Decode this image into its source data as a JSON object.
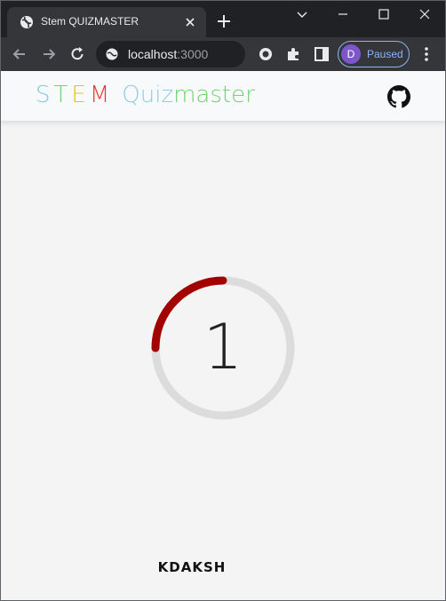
{
  "browser": {
    "tab_title": "Stem QUIZMASTER",
    "url_host": "localhost",
    "url_port": ":3000",
    "profile_initial": "D",
    "profile_status": "Paused"
  },
  "header": {
    "stem_letters": [
      "S",
      "T",
      "E",
      "M"
    ],
    "stem_colors": [
      "#7ec8e3",
      "#6fd36f",
      "#e0c51a",
      "#e53935"
    ],
    "quiz_part": "Quiz",
    "master_part": "master",
    "quiz_color": "#8fcde0",
    "master_color": "#6fd36f",
    "github_icon": "github-icon"
  },
  "timer": {
    "value": "1",
    "progress_fraction": 0.25,
    "track_color": "#dcdcdc",
    "progress_color": "#a30000"
  },
  "footer": {
    "author": "KDAKSH"
  }
}
